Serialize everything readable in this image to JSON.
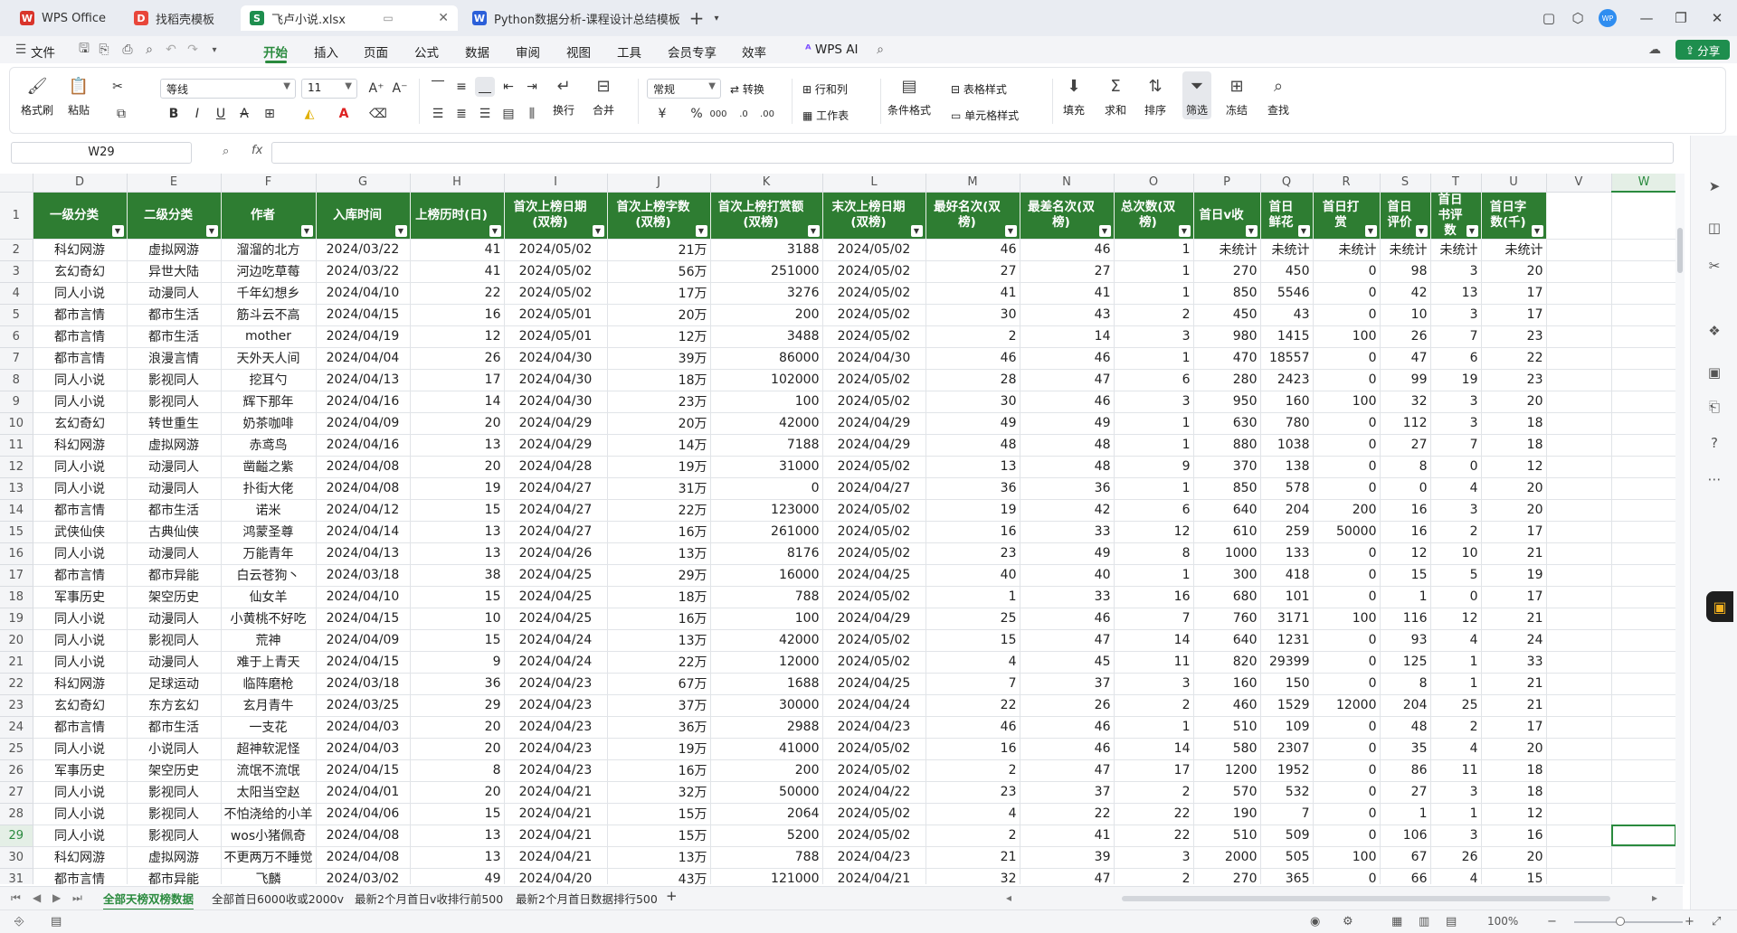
{
  "titlebar": {
    "tabs": [
      {
        "label": "WPS Office",
        "icon": "wps-logo-icon",
        "color": "#d9342b"
      },
      {
        "label": "找稻壳模板",
        "icon": "docer-icon",
        "color": "#e8463a"
      },
      {
        "label": "飞卢小说.xlsx",
        "icon": "spreadsheet-icon",
        "color": "#1e8e4e"
      },
      {
        "label": "Python数据分析-课程设计总结模板.d",
        "icon": "word-doc-icon",
        "color": "#2b5fd9"
      }
    ],
    "new_tab": "+",
    "avatar_text": "WP"
  },
  "menubar": {
    "file": "文件",
    "items": [
      "开始",
      "插入",
      "页面",
      "公式",
      "数据",
      "审阅",
      "视图",
      "工具",
      "会员专享",
      "效率"
    ],
    "active": "开始",
    "wps_ai": "WPS AI",
    "share": "分享"
  },
  "ribbon": {
    "format_painter": "格式刷",
    "paste": "粘贴",
    "font_name": "等线",
    "font_size": "11",
    "number_format": "常规",
    "convert": "转换",
    "rows_cols": "行和列",
    "worksheet": "工作表",
    "wrap": "换行",
    "merge": "合并",
    "cond_format": "条件格式",
    "table_style": "表格样式",
    "cell_style": "单元格样式",
    "fill": "填充",
    "sum": "求和",
    "sort": "排序",
    "filter": "筛选",
    "freeze": "冻结",
    "find": "查找",
    "bold": "B",
    "italic": "I",
    "underline": "U",
    "strike": "A",
    "font_color": "A",
    "currency": "¥",
    "percent": "%"
  },
  "formula_bar": {
    "cell_ref": "W29",
    "fx": "fx",
    "value": ""
  },
  "sheet": {
    "columns": [
      "D",
      "E",
      "F",
      "G",
      "H",
      "I",
      "J",
      "K",
      "L",
      "M",
      "N",
      "O",
      "P",
      "Q",
      "R",
      "S",
      "T",
      "U",
      "V",
      "W"
    ],
    "headers": [
      "一级分类",
      "二级分类",
      "作者",
      "入库时间",
      "上榜历时(日)",
      "首次上榜日期(双榜)",
      "首次上榜字数(双榜)",
      "首次上榜打赏额(双榜)",
      "末次上榜日期(双榜)",
      "最好名次(双榜)",
      "最差名次(双榜)",
      "总次数(双榜)",
      "首日v收",
      "首日鲜花",
      "首日打赏",
      "首日评价",
      "首日书评数",
      "首日字数(千)"
    ],
    "rows": [
      {
        "n": "2",
        "cells": [
          "科幻网游",
          "虚拟网游",
          "溜溜的北方",
          "2024/03/22",
          "41",
          "2024/05/02",
          "21万",
          "3188",
          "2024/05/02",
          "46",
          "46",
          "1",
          "未统计",
          "未统计",
          "未统计",
          "未统计",
          "未统计",
          "未统计"
        ]
      },
      {
        "n": "3",
        "cells": [
          "玄幻奇幻",
          "异世大陆",
          "河边吃草莓",
          "2024/03/22",
          "41",
          "2024/05/02",
          "56万",
          "251000",
          "2024/05/02",
          "27",
          "27",
          "1",
          "270",
          "450",
          "0",
          "98",
          "3",
          "20"
        ]
      },
      {
        "n": "4",
        "cells": [
          "同人小说",
          "动漫同人",
          "千年幻想乡",
          "2024/04/10",
          "22",
          "2024/05/02",
          "17万",
          "3276",
          "2024/05/02",
          "41",
          "41",
          "1",
          "850",
          "5546",
          "0",
          "42",
          "13",
          "17"
        ]
      },
      {
        "n": "5",
        "cells": [
          "都市言情",
          "都市生活",
          "筋斗云不高",
          "2024/04/15",
          "16",
          "2024/05/01",
          "20万",
          "200",
          "2024/05/02",
          "30",
          "43",
          "2",
          "450",
          "43",
          "0",
          "10",
          "3",
          "17"
        ]
      },
      {
        "n": "6",
        "cells": [
          "都市言情",
          "都市生活",
          "mother",
          "2024/04/19",
          "12",
          "2024/05/01",
          "12万",
          "3488",
          "2024/05/02",
          "2",
          "14",
          "3",
          "980",
          "1415",
          "100",
          "26",
          "7",
          "23"
        ]
      },
      {
        "n": "7",
        "cells": [
          "都市言情",
          "浪漫言情",
          "天外天人间",
          "2024/04/04",
          "26",
          "2024/04/30",
          "39万",
          "86000",
          "2024/04/30",
          "46",
          "46",
          "1",
          "470",
          "18557",
          "0",
          "47",
          "6",
          "22"
        ]
      },
      {
        "n": "8",
        "cells": [
          "同人小说",
          "影视同人",
          "挖耳勺",
          "2024/04/13",
          "17",
          "2024/04/30",
          "18万",
          "102000",
          "2024/05/02",
          "28",
          "47",
          "6",
          "280",
          "2423",
          "0",
          "99",
          "19",
          "23"
        ]
      },
      {
        "n": "9",
        "cells": [
          "同人小说",
          "影视同人",
          "辉下那年",
          "2024/04/16",
          "14",
          "2024/04/30",
          "23万",
          "100",
          "2024/05/02",
          "30",
          "46",
          "3",
          "950",
          "160",
          "100",
          "32",
          "3",
          "20"
        ]
      },
      {
        "n": "10",
        "cells": [
          "玄幻奇幻",
          "转世重生",
          "奶茶咖啡",
          "2024/04/09",
          "20",
          "2024/04/29",
          "20万",
          "42000",
          "2024/04/29",
          "49",
          "49",
          "1",
          "630",
          "780",
          "0",
          "112",
          "3",
          "18"
        ]
      },
      {
        "n": "11",
        "cells": [
          "科幻网游",
          "虚拟网游",
          "赤鸢鸟",
          "2024/04/16",
          "13",
          "2024/04/29",
          "14万",
          "7188",
          "2024/04/29",
          "48",
          "48",
          "1",
          "880",
          "1038",
          "0",
          "27",
          "7",
          "18"
        ]
      },
      {
        "n": "12",
        "cells": [
          "同人小说",
          "动漫同人",
          "凿齸之紫",
          "2024/04/08",
          "20",
          "2024/04/28",
          "19万",
          "31000",
          "2024/05/02",
          "13",
          "48",
          "9",
          "370",
          "138",
          "0",
          "8",
          "0",
          "12"
        ]
      },
      {
        "n": "13",
        "cells": [
          "同人小说",
          "动漫同人",
          "扑街大佬",
          "2024/04/08",
          "19",
          "2024/04/27",
          "31万",
          "0",
          "2024/04/27",
          "36",
          "36",
          "1",
          "850",
          "578",
          "0",
          "0",
          "4",
          "20"
        ]
      },
      {
        "n": "14",
        "cells": [
          "都市言情",
          "都市生活",
          "诺米",
          "2024/04/12",
          "15",
          "2024/04/27",
          "22万",
          "123000",
          "2024/05/02",
          "19",
          "42",
          "6",
          "640",
          "204",
          "200",
          "16",
          "3",
          "20"
        ]
      },
      {
        "n": "15",
        "cells": [
          "武侠仙侠",
          "古典仙侠",
          "鸿蒙圣尊",
          "2024/04/14",
          "13",
          "2024/04/27",
          "16万",
          "261000",
          "2024/05/02",
          "16",
          "33",
          "12",
          "610",
          "259",
          "50000",
          "16",
          "2",
          "17"
        ]
      },
      {
        "n": "16",
        "cells": [
          "同人小说",
          "动漫同人",
          "万能青年",
          "2024/04/13",
          "13",
          "2024/04/26",
          "13万",
          "8176",
          "2024/05/02",
          "23",
          "49",
          "8",
          "1000",
          "133",
          "0",
          "12",
          "10",
          "21"
        ]
      },
      {
        "n": "17",
        "cells": [
          "都市言情",
          "都市异能",
          "白云苍狗丶",
          "2024/03/18",
          "38",
          "2024/04/25",
          "29万",
          "16000",
          "2024/04/25",
          "40",
          "40",
          "1",
          "300",
          "418",
          "0",
          "15",
          "5",
          "19"
        ]
      },
      {
        "n": "18",
        "cells": [
          "军事历史",
          "架空历史",
          "仙女羊",
          "2024/04/10",
          "15",
          "2024/04/25",
          "18万",
          "788",
          "2024/05/02",
          "1",
          "33",
          "16",
          "680",
          "101",
          "0",
          "1",
          "0",
          "17"
        ]
      },
      {
        "n": "19",
        "cells": [
          "同人小说",
          "动漫同人",
          "小黄桃不好吃",
          "2024/04/15",
          "10",
          "2024/04/25",
          "16万",
          "100",
          "2024/04/29",
          "25",
          "46",
          "7",
          "760",
          "3171",
          "100",
          "116",
          "12",
          "21"
        ]
      },
      {
        "n": "20",
        "cells": [
          "同人小说",
          "影视同人",
          "荒神",
          "2024/04/09",
          "15",
          "2024/04/24",
          "13万",
          "42000",
          "2024/05/02",
          "15",
          "47",
          "14",
          "640",
          "1231",
          "0",
          "93",
          "4",
          "24"
        ]
      },
      {
        "n": "21",
        "cells": [
          "同人小说",
          "动漫同人",
          "难于上青天",
          "2024/04/15",
          "9",
          "2024/04/24",
          "22万",
          "12000",
          "2024/05/02",
          "4",
          "45",
          "11",
          "820",
          "29399",
          "0",
          "125",
          "1",
          "33"
        ]
      },
      {
        "n": "22",
        "cells": [
          "科幻网游",
          "足球运动",
          "临阵磨枪",
          "2024/03/18",
          "36",
          "2024/04/23",
          "67万",
          "1688",
          "2024/04/25",
          "7",
          "37",
          "3",
          "160",
          "150",
          "0",
          "8",
          "1",
          "21"
        ]
      },
      {
        "n": "23",
        "cells": [
          "玄幻奇幻",
          "东方玄幻",
          "玄月青牛",
          "2024/03/25",
          "29",
          "2024/04/23",
          "37万",
          "30000",
          "2024/04/24",
          "22",
          "26",
          "2",
          "460",
          "1529",
          "12000",
          "204",
          "25",
          "21"
        ]
      },
      {
        "n": "24",
        "cells": [
          "都市言情",
          "都市生活",
          "一支花",
          "2024/04/03",
          "20",
          "2024/04/23",
          "36万",
          "2988",
          "2024/04/23",
          "46",
          "46",
          "1",
          "510",
          "109",
          "0",
          "48",
          "2",
          "17"
        ]
      },
      {
        "n": "25",
        "cells": [
          "同人小说",
          "小说同人",
          "超神软泥怪",
          "2024/04/03",
          "20",
          "2024/04/23",
          "19万",
          "41000",
          "2024/05/02",
          "16",
          "46",
          "14",
          "580",
          "2307",
          "0",
          "35",
          "4",
          "20"
        ]
      },
      {
        "n": "26",
        "cells": [
          "军事历史",
          "架空历史",
          "流氓不流氓",
          "2024/04/15",
          "8",
          "2024/04/23",
          "16万",
          "200",
          "2024/05/02",
          "2",
          "47",
          "17",
          "1200",
          "1952",
          "0",
          "86",
          "11",
          "18"
        ]
      },
      {
        "n": "27",
        "cells": [
          "同人小说",
          "影视同人",
          "太阳当空赵",
          "2024/04/01",
          "20",
          "2024/04/21",
          "32万",
          "50000",
          "2024/04/22",
          "23",
          "37",
          "2",
          "570",
          "532",
          "0",
          "27",
          "3",
          "18"
        ]
      },
      {
        "n": "28",
        "cells": [
          "同人小说",
          "影视同人",
          "不怕浇给的小羊",
          "2024/04/06",
          "15",
          "2024/04/21",
          "15万",
          "2064",
          "2024/05/02",
          "4",
          "22",
          "22",
          "190",
          "7",
          "0",
          "1",
          "1",
          "12"
        ]
      },
      {
        "n": "29",
        "cells": [
          "同人小说",
          "影视同人",
          "wos小猪佩奇",
          "2024/04/08",
          "13",
          "2024/04/21",
          "15万",
          "5200",
          "2024/05/02",
          "2",
          "41",
          "22",
          "510",
          "509",
          "0",
          "106",
          "3",
          "16"
        ]
      },
      {
        "n": "30",
        "cells": [
          "科幻网游",
          "虚拟网游",
          "不更两万不睡觉",
          "2024/04/08",
          "13",
          "2024/04/21",
          "13万",
          "788",
          "2024/04/23",
          "21",
          "39",
          "3",
          "2000",
          "505",
          "100",
          "67",
          "26",
          "20"
        ]
      },
      {
        "n": "31",
        "cells": [
          "都市言情",
          "都市异能",
          "飞麟",
          "2024/03/02",
          "49",
          "2024/04/20",
          "43万",
          "121000",
          "2024/04/21",
          "32",
          "47",
          "2",
          "270",
          "365",
          "0",
          "66",
          "4",
          "15"
        ]
      }
    ],
    "selected_cell": "W29",
    "header_color": "#2e7d32"
  },
  "sheet_tabs": [
    "全部天榜双榜数据",
    "全部首日6000收或2000v",
    "最新2个月首日v收排行前500",
    "最新2个月首日数据排行500"
  ],
  "active_sheet": "全部天榜双榜数据",
  "status": {
    "zoom": "100%"
  }
}
